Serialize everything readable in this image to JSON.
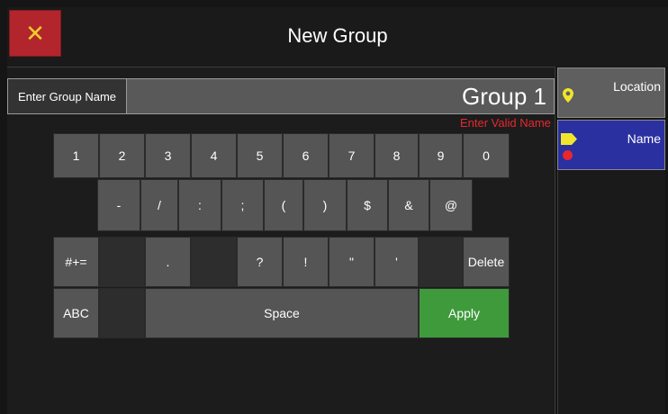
{
  "header": {
    "title": "New Group",
    "close_symbol": "✕"
  },
  "input": {
    "label": "Enter Group Name",
    "value": "Group 1",
    "error": "Enter Valid Name"
  },
  "keyboard": {
    "row1": [
      "1",
      "2",
      "3",
      "4",
      "5",
      "6",
      "7",
      "8",
      "9",
      "0"
    ],
    "row2": [
      "-",
      "/",
      ":",
      ";",
      "(",
      ")",
      "$",
      "&",
      "@"
    ],
    "row3": [
      "#+=",
      "",
      ".",
      "",
      "?",
      "!",
      "\"",
      "'",
      "",
      "Delete"
    ],
    "row4": [
      "ABC",
      "",
      "Space",
      "Apply"
    ]
  },
  "sidebar": {
    "tabs": [
      {
        "label": "Location",
        "icon": "map-pin-icon"
      },
      {
        "label": "Name",
        "icon": "tag-icon"
      }
    ]
  },
  "colors": {
    "accent_red": "#b3252d",
    "close_x": "#f1cd2b",
    "selected_tab": "#2a30a0",
    "apply": "#3f9a3c",
    "error": "#e8272e"
  }
}
